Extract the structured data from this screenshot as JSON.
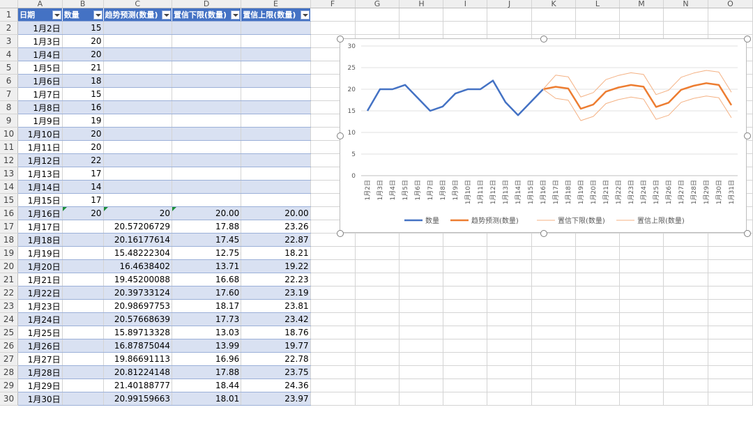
{
  "columns": [
    "A",
    "B",
    "C",
    "D",
    "E",
    "F",
    "G",
    "H",
    "I",
    "J",
    "K",
    "L",
    "M",
    "N",
    "O"
  ],
  "rowNumbers": [
    "1",
    "2",
    "3",
    "4",
    "5",
    "6",
    "7",
    "8",
    "9",
    "10",
    "11",
    "12",
    "13",
    "14",
    "15",
    "16",
    "17",
    "18",
    "19",
    "20",
    "21",
    "22",
    "23",
    "24",
    "25",
    "26",
    "27",
    "28",
    "29",
    "30"
  ],
  "table": {
    "headers": [
      "日期",
      "数量",
      "趋势预测(数量)",
      "置信下限(数量)",
      "置信上限(数量)"
    ],
    "rows": [
      [
        "1月2日",
        "15",
        "",
        "",
        ""
      ],
      [
        "1月3日",
        "20",
        "",
        "",
        ""
      ],
      [
        "1月4日",
        "20",
        "",
        "",
        ""
      ],
      [
        "1月5日",
        "21",
        "",
        "",
        ""
      ],
      [
        "1月6日",
        "18",
        "",
        "",
        ""
      ],
      [
        "1月7日",
        "15",
        "",
        "",
        ""
      ],
      [
        "1月8日",
        "16",
        "",
        "",
        ""
      ],
      [
        "1月9日",
        "19",
        "",
        "",
        ""
      ],
      [
        "1月10日",
        "20",
        "",
        "",
        ""
      ],
      [
        "1月11日",
        "20",
        "",
        "",
        ""
      ],
      [
        "1月12日",
        "22",
        "",
        "",
        ""
      ],
      [
        "1月13日",
        "17",
        "",
        "",
        ""
      ],
      [
        "1月14日",
        "14",
        "",
        "",
        ""
      ],
      [
        "1月15日",
        "17",
        "",
        "",
        ""
      ],
      [
        "1月16日",
        "20",
        "20",
        "20.00",
        "20.00"
      ],
      [
        "1月17日",
        "",
        "20.57206729",
        "17.88",
        "23.26"
      ],
      [
        "1月18日",
        "",
        "20.16177614",
        "17.45",
        "22.87"
      ],
      [
        "1月19日",
        "",
        "15.48222304",
        "12.75",
        "18.21"
      ],
      [
        "1月20日",
        "",
        "16.4638402",
        "13.71",
        "19.22"
      ],
      [
        "1月21日",
        "",
        "19.45200088",
        "16.68",
        "22.23"
      ],
      [
        "1月22日",
        "",
        "20.39733124",
        "17.60",
        "23.19"
      ],
      [
        "1月23日",
        "",
        "20.98697753",
        "18.17",
        "23.81"
      ],
      [
        "1月24日",
        "",
        "20.57668639",
        "17.73",
        "23.42"
      ],
      [
        "1月25日",
        "",
        "15.89713328",
        "13.03",
        "18.76"
      ],
      [
        "1月26日",
        "",
        "16.87875044",
        "13.99",
        "19.77"
      ],
      [
        "1月27日",
        "",
        "19.86691113",
        "16.96",
        "22.78"
      ],
      [
        "1月28日",
        "",
        "20.81224148",
        "17.88",
        "23.75"
      ],
      [
        "1月29日",
        "",
        "21.40188777",
        "18.44",
        "24.36"
      ],
      [
        "1月30日",
        "",
        "20.99159663",
        "18.01",
        "23.97"
      ]
    ]
  },
  "chart_data": {
    "type": "line",
    "categories": [
      "1月2日",
      "1月3日",
      "1月4日",
      "1月5日",
      "1月6日",
      "1月7日",
      "1月8日",
      "1月9日",
      "1月10日",
      "1月11日",
      "1月12日",
      "1月13日",
      "1月14日",
      "1月15日",
      "1月16日",
      "1月17日",
      "1月18日",
      "1月19日",
      "1月20日",
      "1月21日",
      "1月22日",
      "1月23日",
      "1月24日",
      "1月25日",
      "1月26日",
      "1月27日",
      "1月28日",
      "1月29日",
      "1月30日",
      "1月31日"
    ],
    "ylim": [
      0,
      30
    ],
    "yticks": [
      "0",
      "5",
      "10",
      "15",
      "20",
      "25",
      "30"
    ],
    "grid": true,
    "legend_position": "bottom",
    "series": [
      {
        "name": "数量",
        "color": "#4472c4",
        "values": [
          15,
          20,
          20,
          21,
          18,
          15,
          16,
          19,
          20,
          20,
          22,
          17,
          14,
          17,
          20,
          null,
          null,
          null,
          null,
          null,
          null,
          null,
          null,
          null,
          null,
          null,
          null,
          null,
          null,
          null
        ]
      },
      {
        "name": "趋势预测(数量)",
        "color": "#ed7d31",
        "values": [
          null,
          null,
          null,
          null,
          null,
          null,
          null,
          null,
          null,
          null,
          null,
          null,
          null,
          null,
          20,
          20.57,
          20.16,
          15.48,
          16.46,
          19.45,
          20.4,
          20.99,
          20.58,
          15.9,
          16.88,
          19.87,
          20.81,
          21.4,
          20.99,
          16.3
        ]
      },
      {
        "name": "置信下限(数量)",
        "color": "#f4b183",
        "values": [
          null,
          null,
          null,
          null,
          null,
          null,
          null,
          null,
          null,
          null,
          null,
          null,
          null,
          null,
          20,
          17.88,
          17.45,
          12.75,
          13.71,
          16.68,
          17.6,
          18.17,
          17.73,
          13.03,
          13.99,
          16.96,
          17.88,
          18.44,
          18.01,
          13.4
        ]
      },
      {
        "name": "置信上限(数量)",
        "color": "#f4b183",
        "values": [
          null,
          null,
          null,
          null,
          null,
          null,
          null,
          null,
          null,
          null,
          null,
          null,
          null,
          null,
          20,
          23.26,
          22.87,
          18.21,
          19.22,
          22.23,
          23.19,
          23.81,
          23.42,
          18.76,
          19.77,
          22.78,
          23.75,
          24.36,
          23.97,
          19.3
        ]
      }
    ]
  }
}
